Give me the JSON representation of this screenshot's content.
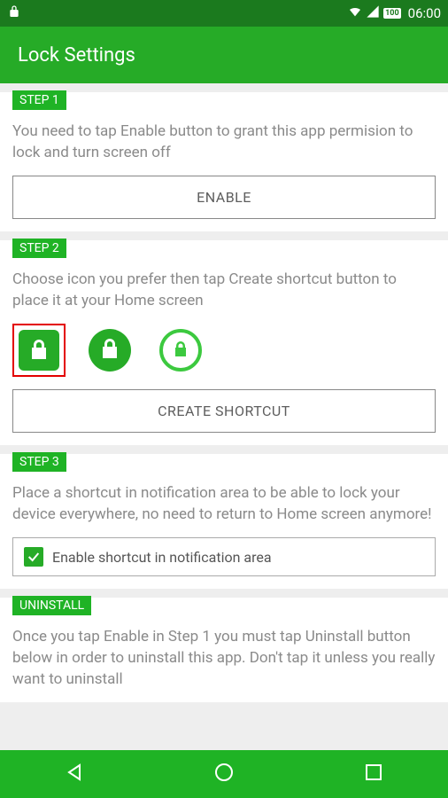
{
  "status": {
    "time": "06:00",
    "battery": "100"
  },
  "appbar": {
    "title": "Lock Settings"
  },
  "steps": {
    "step1": {
      "badge": "STEP 1",
      "desc": "You need to tap Enable button to grant this app permision to lock and turn screen off",
      "button": "ENABLE"
    },
    "step2": {
      "badge": "STEP 2",
      "desc": "Choose icon you prefer then tap Create shortcut button to place it at your Home screen",
      "button": "CREATE SHORTCUT"
    },
    "step3": {
      "badge": "STEP 3",
      "desc": "Place a shortcut in notification area to be able to lock your device everywhere, no need to return to Home screen anymore!",
      "checkbox": "Enable shortcut in notification area"
    },
    "uninstall": {
      "badge": "UNINSTALL",
      "desc": "Once you tap Enable in Step 1 you must tap Uninstall button below in order to uninstall this app. Don't tap it unless you really want to uninstall"
    }
  }
}
